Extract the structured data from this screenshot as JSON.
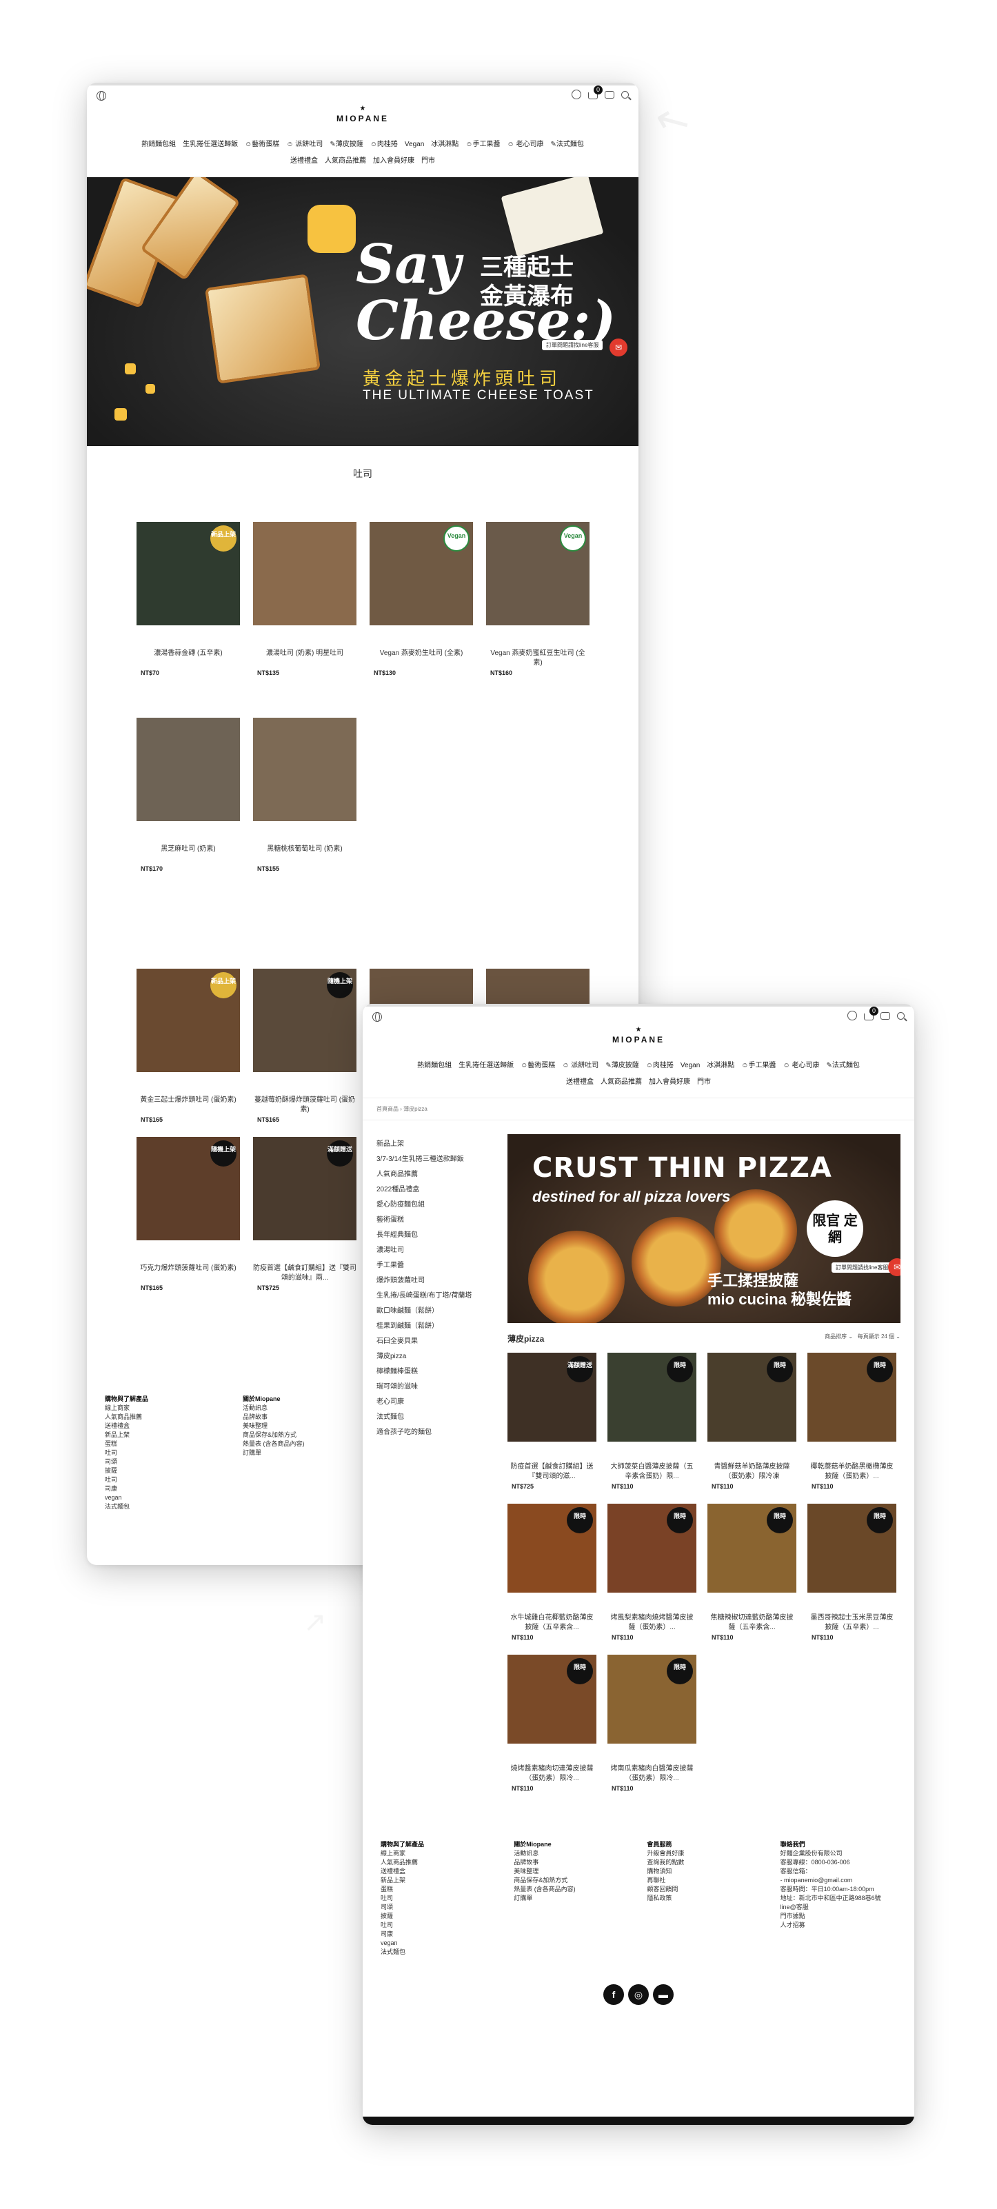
{
  "shop": {
    "logo_text": "MIOPANE"
  },
  "nav": [
    "熱銷麵包組",
    "生乳捲任選送歸飯",
    "☺藝術蛋糕",
    "☺ 派餅吐司",
    "✎薄皮披薩",
    "☺肉桂捲",
    "Vegan",
    "冰淇淋點",
    "☺手工果醬",
    "☺ 老心司康",
    "✎法式麵包",
    "送禮禮盒",
    "人氣商品推薦",
    "加入會員好康",
    "門市"
  ],
  "cart_count": "0",
  "win1": {
    "banner": {
      "say": "Say",
      "cheese": "Cheese:)",
      "zh_line1": "三種起士",
      "zh_line2": "金黃瀑布",
      "zh_sub": "黃金起士爆炸頭吐司",
      "en_sub": "THE ULTIMATE CHEESE TOAST",
      "chat_tip": "訂單問題請找line客服"
    },
    "section_title": "吐司",
    "products_row1": [
      {
        "name": "濃湯香蒜金磚 (五辛素)",
        "price": "NT$70",
        "tag": "新品上架"
      },
      {
        "name": "濃湯吐司 (奶素) 明星吐司",
        "price": "NT$135",
        "tag": ""
      },
      {
        "name": "Vegan 燕麥奶生吐司 (全素)",
        "price": "NT$130",
        "tag": "Vegan"
      },
      {
        "name": "Vegan 燕麥奶蜜紅豆生吐司 (全素)",
        "price": "NT$160",
        "tag": "Vegan"
      }
    ],
    "products_row2": [
      {
        "name": "黑芝麻吐司 (奶素)",
        "price": "NT$170",
        "tag": ""
      },
      {
        "name": "黑糖桃核葡萄吐司 (奶素)",
        "price": "NT$155",
        "tag": ""
      }
    ],
    "products_row3": [
      {
        "name": "黃金三起士爆炸頭吐司 (蛋奶素)",
        "price": "NT$165",
        "tag": "新品上架"
      },
      {
        "name": "蔓越莓奶酥爆炸頭菠蘿吐司 (蛋奶素)",
        "price": "NT$165",
        "tag": "隨機上架"
      },
      {
        "name": "",
        "price": "",
        "tag": ""
      },
      {
        "name": "",
        "price": "",
        "tag": ""
      }
    ],
    "products_row4": [
      {
        "name": "巧克力爆炸頭菠蘿吐司 (蛋奶素)",
        "price": "NT$165",
        "tag": "隨機上架"
      },
      {
        "name": "防疫首選【鹹食訂購組】送『雙司頌的滋味』兩...",
        "price": "NT$725",
        "tag": "滿額贈送"
      }
    ],
    "footer": {
      "col1_title": "購物與了解產品",
      "col1_items": [
        "線上商家",
        "人氣商品推薦",
        "送禮禮盒",
        "新品上架",
        "蛋糕",
        "吐司",
        "司頌",
        "披薩",
        "吐司",
        "司康",
        "vegan",
        "法式麵包"
      ],
      "col2_title": "關於Miopane",
      "col2_items": [
        "活動訊息",
        "品牌故事",
        "美味整理",
        "商品保存&加熱方式",
        "熱量表 (含各商品內容)",
        "訂購單"
      ]
    }
  },
  "win2": {
    "breadcrumb": "首頁商品 › 薄皮pizza",
    "sidebar": [
      "新品上架",
      "3/7-3/14生乳捲三種送款歸飯",
      "人氣商品推薦",
      "2022種品禮盒",
      "愛心防疫麵包組",
      "藝術蛋糕",
      "長年經典麵包",
      "濃湯吐司",
      "手工果醬",
      "爆炸頭菠蘿吐司",
      "生乳捲/長崎蛋糕/布丁塔/荷蘭塔",
      "歐口味鹹麵（鬆餅）",
      "桂果到鹹麵（鬆餅）",
      "石臼全麥貝果",
      "薄皮pizza",
      "檸檬麵棒蛋糕",
      "瑞可頌的滋味",
      "老心司康",
      "法式麵包",
      "適合孩子吃的麵包"
    ],
    "banner": {
      "t1": "CRUST THIN PIZZA",
      "t2": "destined for all pizza lovers",
      "stamp": "限官 定網",
      "t3": "手工揉捏披薩",
      "t4": "mio cucina 秘製佐醬",
      "chat_tip": "訂單問題請找line客服"
    },
    "category_title": "薄皮pizza",
    "sort1": "商品排序 ⌄",
    "sort2": "每頁顯示 24 個 ⌄",
    "products": [
      {
        "name": "防疫首選【鹹食訂購組】送『雙司頌的滋...",
        "price": "NT$725",
        "tag": "滿額贈送"
      },
      {
        "name": "大師菠菜白醬薄皮披薩（五辛素含蛋奶）限...",
        "price": "NT$110",
        "tag": "限時"
      },
      {
        "name": "青醬鮮菇羊奶酪薄皮披薩（蛋奶素）限冷凍",
        "price": "NT$110",
        "tag": "限時"
      },
      {
        "name": "椰乾蘑菇羊奶酪黑橄欖薄皮披薩（蛋奶素）...",
        "price": "NT$110",
        "tag": "限時"
      },
      {
        "name": "水牛城雞白花椰藍奶酪薄皮披薩（五辛素含...",
        "price": "NT$110",
        "tag": "限時"
      },
      {
        "name": "烤風梨素豬肉燒烤醬薄皮披薩（蛋奶素）...",
        "price": "NT$110",
        "tag": "限時"
      },
      {
        "name": "焦糖辣椒切達藍奶酪薄皮披薩（五辛素含...",
        "price": "NT$110",
        "tag": "限時"
      },
      {
        "name": "墨西哥辣起士玉米黑豆薄皮披薩（五辛素）...",
        "price": "NT$110",
        "tag": "限時"
      },
      {
        "name": "燒烤醬素豬肉切達薄皮披薩（蛋奶素）限冷...",
        "price": "NT$110",
        "tag": "限時"
      },
      {
        "name": "烤南瓜素豬肉白醬薄皮披薩（蛋奶素）限冷...",
        "price": "NT$110",
        "tag": "限時"
      }
    ],
    "footer": {
      "col1_title": "購物與了解產品",
      "col1_items": [
        "線上商家",
        "人氣商品推薦",
        "送禮禮盒",
        "新品上架",
        "蛋糕",
        "吐司",
        "司頌",
        "披薩",
        "吐司",
        "司康",
        "vegan",
        "法式麵包"
      ],
      "col2_title": "關於Miopane",
      "col2_items": [
        "活動訊息",
        "品牌故事",
        "美味整理",
        "商品保存&加熱方式",
        "熱量表 (含各商品內容)",
        "訂購單"
      ],
      "col3_title": "會員服務",
      "col3_items": [
        "升級會員好康",
        "查詢我的點數",
        "購物須知",
        "再聯社",
        "顧客回饋問",
        "隱私政策"
      ],
      "col4_title": "聯絡我們",
      "col4_items": [
        "好麵企業股份有限公司",
        "客服專線：0800-036-006",
        "客服信箱：",
        "- miopanemio@gmail.com",
        "客服時間：平日10:00am-18:00pm",
        "地址：新北市中和區中正路988巷6號",
        "line@客服",
        "門市據點",
        "人才招募"
      ]
    },
    "social": [
      "f",
      "◎",
      "▬"
    ]
  },
  "colors": {
    "accent": "#e23b2e",
    "dark": "#111111"
  }
}
